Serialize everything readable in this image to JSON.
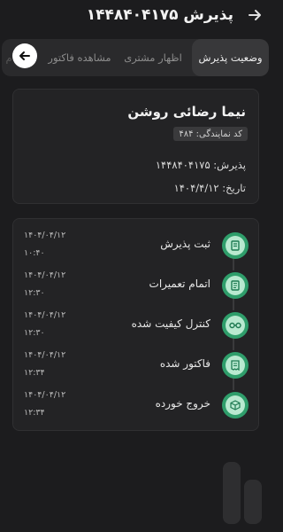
{
  "header": {
    "title": "پذیرش ۱۴۴۸۴۰۴۱۷۵",
    "back_icon": "arrow-right-icon"
  },
  "tabs": [
    {
      "label": "وضعیت پذیرش",
      "active": true
    },
    {
      "label": "اظهار مشتری",
      "active": false
    },
    {
      "label": "مشاهده فاکتور",
      "active": false
    },
    {
      "label": "م",
      "active": false
    }
  ],
  "tab_scroll_icon": "arrow-left-icon",
  "info": {
    "name": "نیما رضائی روشن",
    "agent_code": "کد نمایندگی: ۴۸۴",
    "reception": "پذیرش: ۱۴۴۸۴۰۴۱۷۵",
    "date": "تاریخ: ۱۴۰۴/۴/۱۲"
  },
  "timeline": [
    {
      "label": "ثبت پذیرش",
      "date": "۱۴۰۴/۰۴/۱۲",
      "time": "۱۰:۴۰",
      "icon": "document-icon"
    },
    {
      "label": "اتمام تعمیرات",
      "date": "۱۴۰۴/۰۴/۱۲",
      "time": "۱۲:۳۰",
      "icon": "document-list-icon"
    },
    {
      "label": "کنترل کیفیت شده",
      "date": "۱۴۰۴/۰۴/۱۲",
      "time": "۱۲:۳۰",
      "icon": "glasses-icon"
    },
    {
      "label": "فاکتور شده",
      "date": "۱۴۰۴/۰۴/۱۲",
      "time": "۱۲:۳۴",
      "icon": "invoice-icon"
    },
    {
      "label": "خروج خورده",
      "date": "۱۴۰۴/۰۴/۱۲",
      "time": "۱۲:۳۴",
      "icon": "box-icon"
    }
  ],
  "colors": {
    "accent": "#2f9e6b",
    "accent_light": "#b9e9d0",
    "background": "#1c1c1e",
    "card": "#232325"
  }
}
